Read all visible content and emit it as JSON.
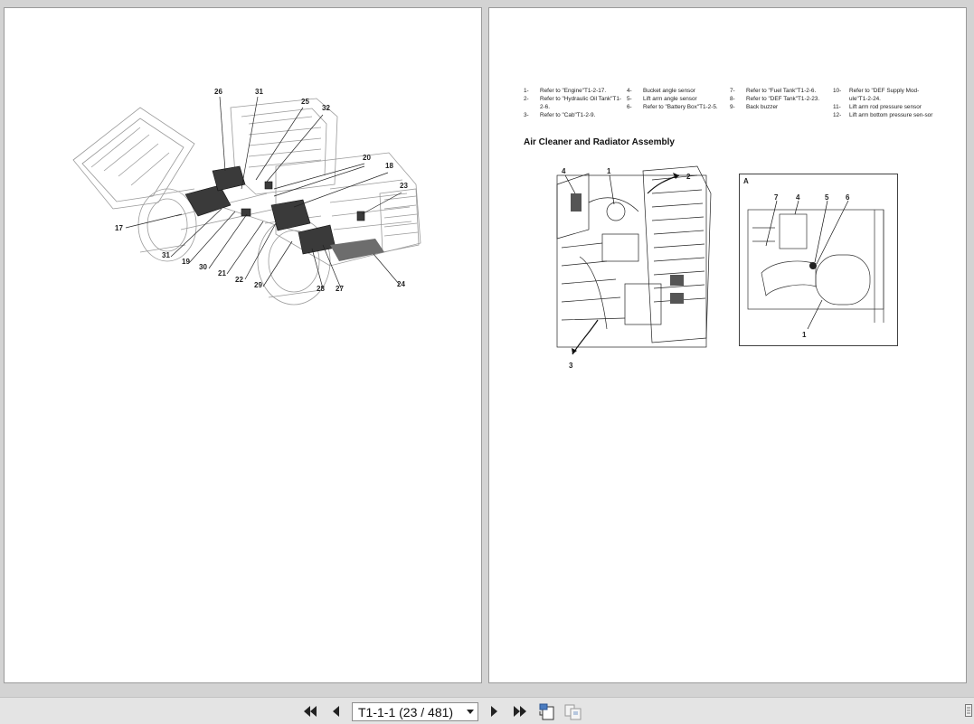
{
  "viewer": {
    "page_indicator": "T1-1-1 (23 / 481)",
    "buttons": {
      "first_page": "first-page-icon",
      "prev_page": "previous-page-icon",
      "next_page": "next-page-icon",
      "last_page": "last-page-icon",
      "single_page_view": "single-page-view-icon",
      "two_page_view": "two-page-view-icon"
    }
  },
  "left_page": {
    "callouts": [
      "26",
      "31",
      "25",
      "32",
      "20",
      "18",
      "23",
      "17",
      "31",
      "19",
      "30",
      "21",
      "22",
      "29",
      "28",
      "27",
      "24"
    ]
  },
  "right_page": {
    "legend": [
      {
        "num": "1-",
        "text": "Refer to \"Engine\"T1-2-17."
      },
      {
        "num": "2-",
        "text": "Refer to \"Hydraulic Oil Tank\"T1-2-6."
      },
      {
        "num": "3-",
        "text": "Refer to \"Cab\"T1-2-9."
      },
      {
        "num": "4-",
        "text": "Bucket angle sensor"
      },
      {
        "num": "5-",
        "text": "Lift arm angle sensor"
      },
      {
        "num": "6-",
        "text": "Refer to \"Battery Box\"T1-2-5."
      },
      {
        "num": "7-",
        "text": "Refer to \"Fuel Tank\"T1-2-6."
      },
      {
        "num": "8-",
        "text": "Refer to \"DEF Tank\"T1-2-23."
      },
      {
        "num": "9-",
        "text": "Back buzzer"
      },
      {
        "num": "10-",
        "text": "Refer to \"DEF Supply Mod-ule\"T1-2-24."
      },
      {
        "num": "11-",
        "text": "Lift arm rod pressure sensor"
      },
      {
        "num": "12-",
        "text": "Lift arm bottom pressure sen-sor"
      }
    ],
    "section_title": "Air Cleaner and Radiator Assembly",
    "figure1_callouts": [
      "4",
      "1",
      "2",
      "3"
    ],
    "figure2_label": "A",
    "figure2_callouts": [
      "7",
      "4",
      "5",
      "6",
      "1"
    ]
  }
}
